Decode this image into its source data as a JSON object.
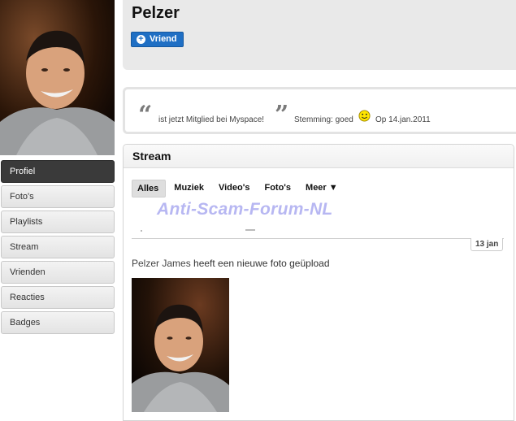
{
  "profile": {
    "name": "Pelzer",
    "friend_button": "Vriend"
  },
  "nav": {
    "items": [
      "Profiel",
      "Foto's",
      "Playlists",
      "Stream",
      "Vrienden",
      "Reacties",
      "Badges"
    ],
    "active": "Profiel"
  },
  "status": {
    "text": "ist jetzt Mitglied bei Myspace!",
    "mood": "Stemming: goed",
    "date": "Op 14.jan.2011"
  },
  "stream": {
    "title": "Stream",
    "tabs": [
      "Alles",
      "Muziek",
      "Video's",
      "Foto's",
      "Meer ▼"
    ],
    "active_tab": "Alles",
    "watermark": "Anti-Scam-Forum-NL",
    "date_badge": "13 jan",
    "activity_user": "Pelzer James",
    "activity_text": " heeft een nieuwe foto geüpload"
  },
  "icons": {
    "friend": "plus-circle-icon",
    "mood": "smiley-icon"
  },
  "colors": {
    "accent": "#1f6fc4",
    "active_nav": "#3a3a3a",
    "watermark": "#b7b7f2"
  }
}
